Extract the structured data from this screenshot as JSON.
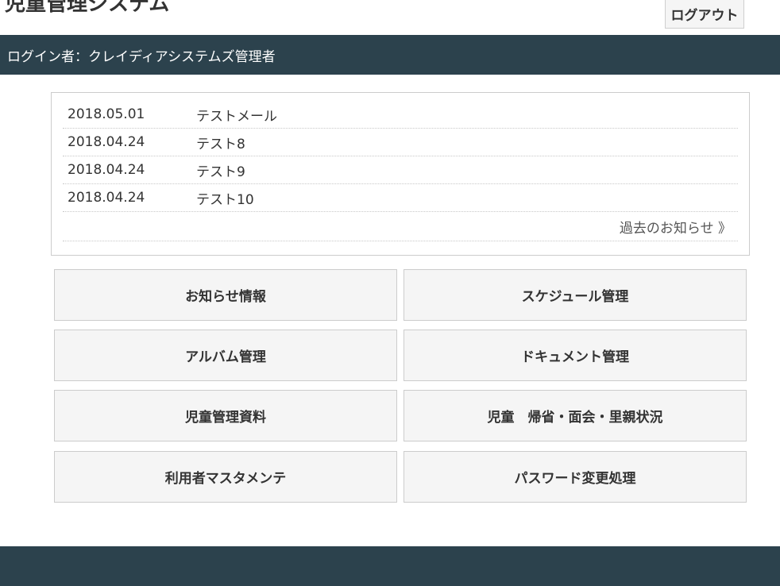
{
  "header": {
    "title": "児童管理システム",
    "logout_label": "ログアウト"
  },
  "login_bar": {
    "text": "ログイン者：クレイディアシステムズ管理者"
  },
  "news": {
    "items": [
      {
        "date": "2018.05.01",
        "subject": "テストメール"
      },
      {
        "date": "2018.04.24",
        "subject": "テスト8"
      },
      {
        "date": "2018.04.24",
        "subject": "テスト9"
      },
      {
        "date": "2018.04.24",
        "subject": "テスト10"
      }
    ],
    "past_link": "過去のお知らせ 》"
  },
  "menu": {
    "notice_info": "お知らせ情報",
    "schedule": "スケジュール管理",
    "album": "アルバム管理",
    "document": "ドキュメント管理",
    "child_materials": "児童管理資料",
    "child_status": "児童　帰省・面会・里親状況",
    "user_master": "利用者マスタメンテ",
    "password_change": "パスワード変更処理"
  },
  "colors": {
    "bar": "#2c424d",
    "button_bg": "#f5f5f5",
    "border": "#cccccc"
  }
}
